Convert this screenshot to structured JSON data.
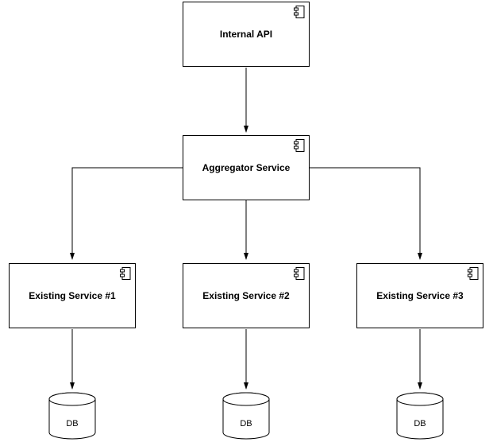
{
  "components": {
    "internal_api": {
      "label": "Internal API"
    },
    "aggregator": {
      "label": "Aggregator Service"
    },
    "svc1": {
      "label": "Existing Service #1"
    },
    "svc2": {
      "label": "Existing Service #2"
    },
    "svc3": {
      "label": "Existing Service #3"
    }
  },
  "db": {
    "db1": {
      "label": "DB"
    },
    "db2": {
      "label": "DB"
    },
    "db3": {
      "label": "DB"
    }
  }
}
